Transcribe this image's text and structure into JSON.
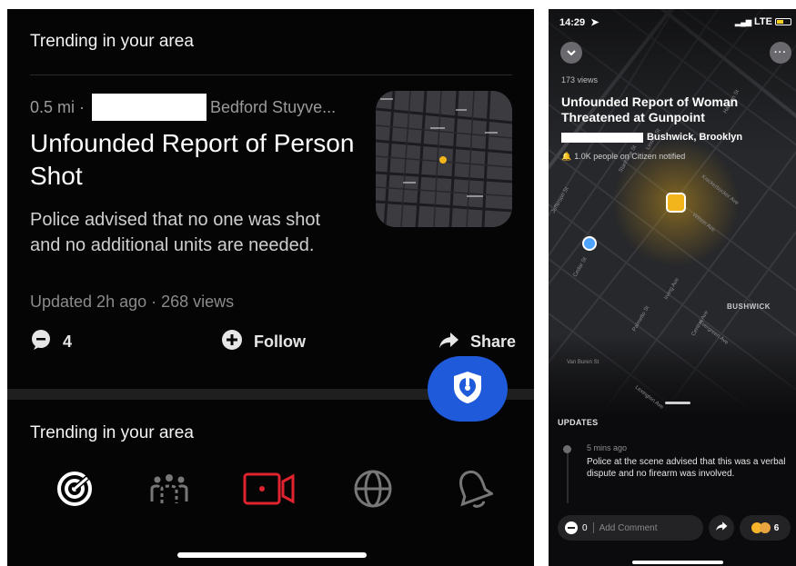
{
  "left": {
    "section_title_top": "Trending in your area",
    "incident": {
      "distance": "0.5 mi ·",
      "neighborhood": "Bedford Stuyve...",
      "title": "Unfounded Report of Person Shot",
      "description": "Police advised that no one was shot and no additional units are needed.",
      "updated": "Updated 2h ago · 268 views"
    },
    "actions": {
      "comment_count": "4",
      "follow_label": "Follow",
      "share_label": "Share"
    },
    "section_title_bottom": "Trending in your area",
    "tabs": [
      {
        "icon": "radar-icon",
        "active": true
      },
      {
        "icon": "people-icon",
        "active": false
      },
      {
        "icon": "video-record-icon",
        "active": false
      },
      {
        "icon": "globe-icon",
        "active": false
      },
      {
        "icon": "bell-icon",
        "active": false
      }
    ],
    "colors": {
      "fab": "#1e5ad9",
      "record": "#e0242f",
      "incident_pin": "#f2b51c"
    }
  },
  "right": {
    "status_time": "14:29",
    "status_network": "LTE",
    "views": "173 views",
    "title": "Unfounded Report of Woman Threatened at Gunpoint",
    "location": "Bushwick, Brooklyn",
    "notified": "1.0K people on Citizen notified",
    "map_labels": [
      "BUSHWICK",
      "Jefferson St",
      "Wilson Ave",
      "Knickerbocker Ave",
      "Irving Ave",
      "Central Ave",
      "Cedar St",
      "Evergreen Ave",
      "Van Buren St",
      "Lexington Ave",
      "Stanhope St",
      "Harman St",
      "Linden St",
      "Palmetto St"
    ],
    "updates_heading": "UPDATES",
    "update": {
      "time": "5 mins ago",
      "text": "Police at the scene advised that this was a verbal dispute and no firearm was involved."
    },
    "comment_count": "0",
    "comment_placeholder": "Add Comment",
    "reaction_count": "6"
  }
}
